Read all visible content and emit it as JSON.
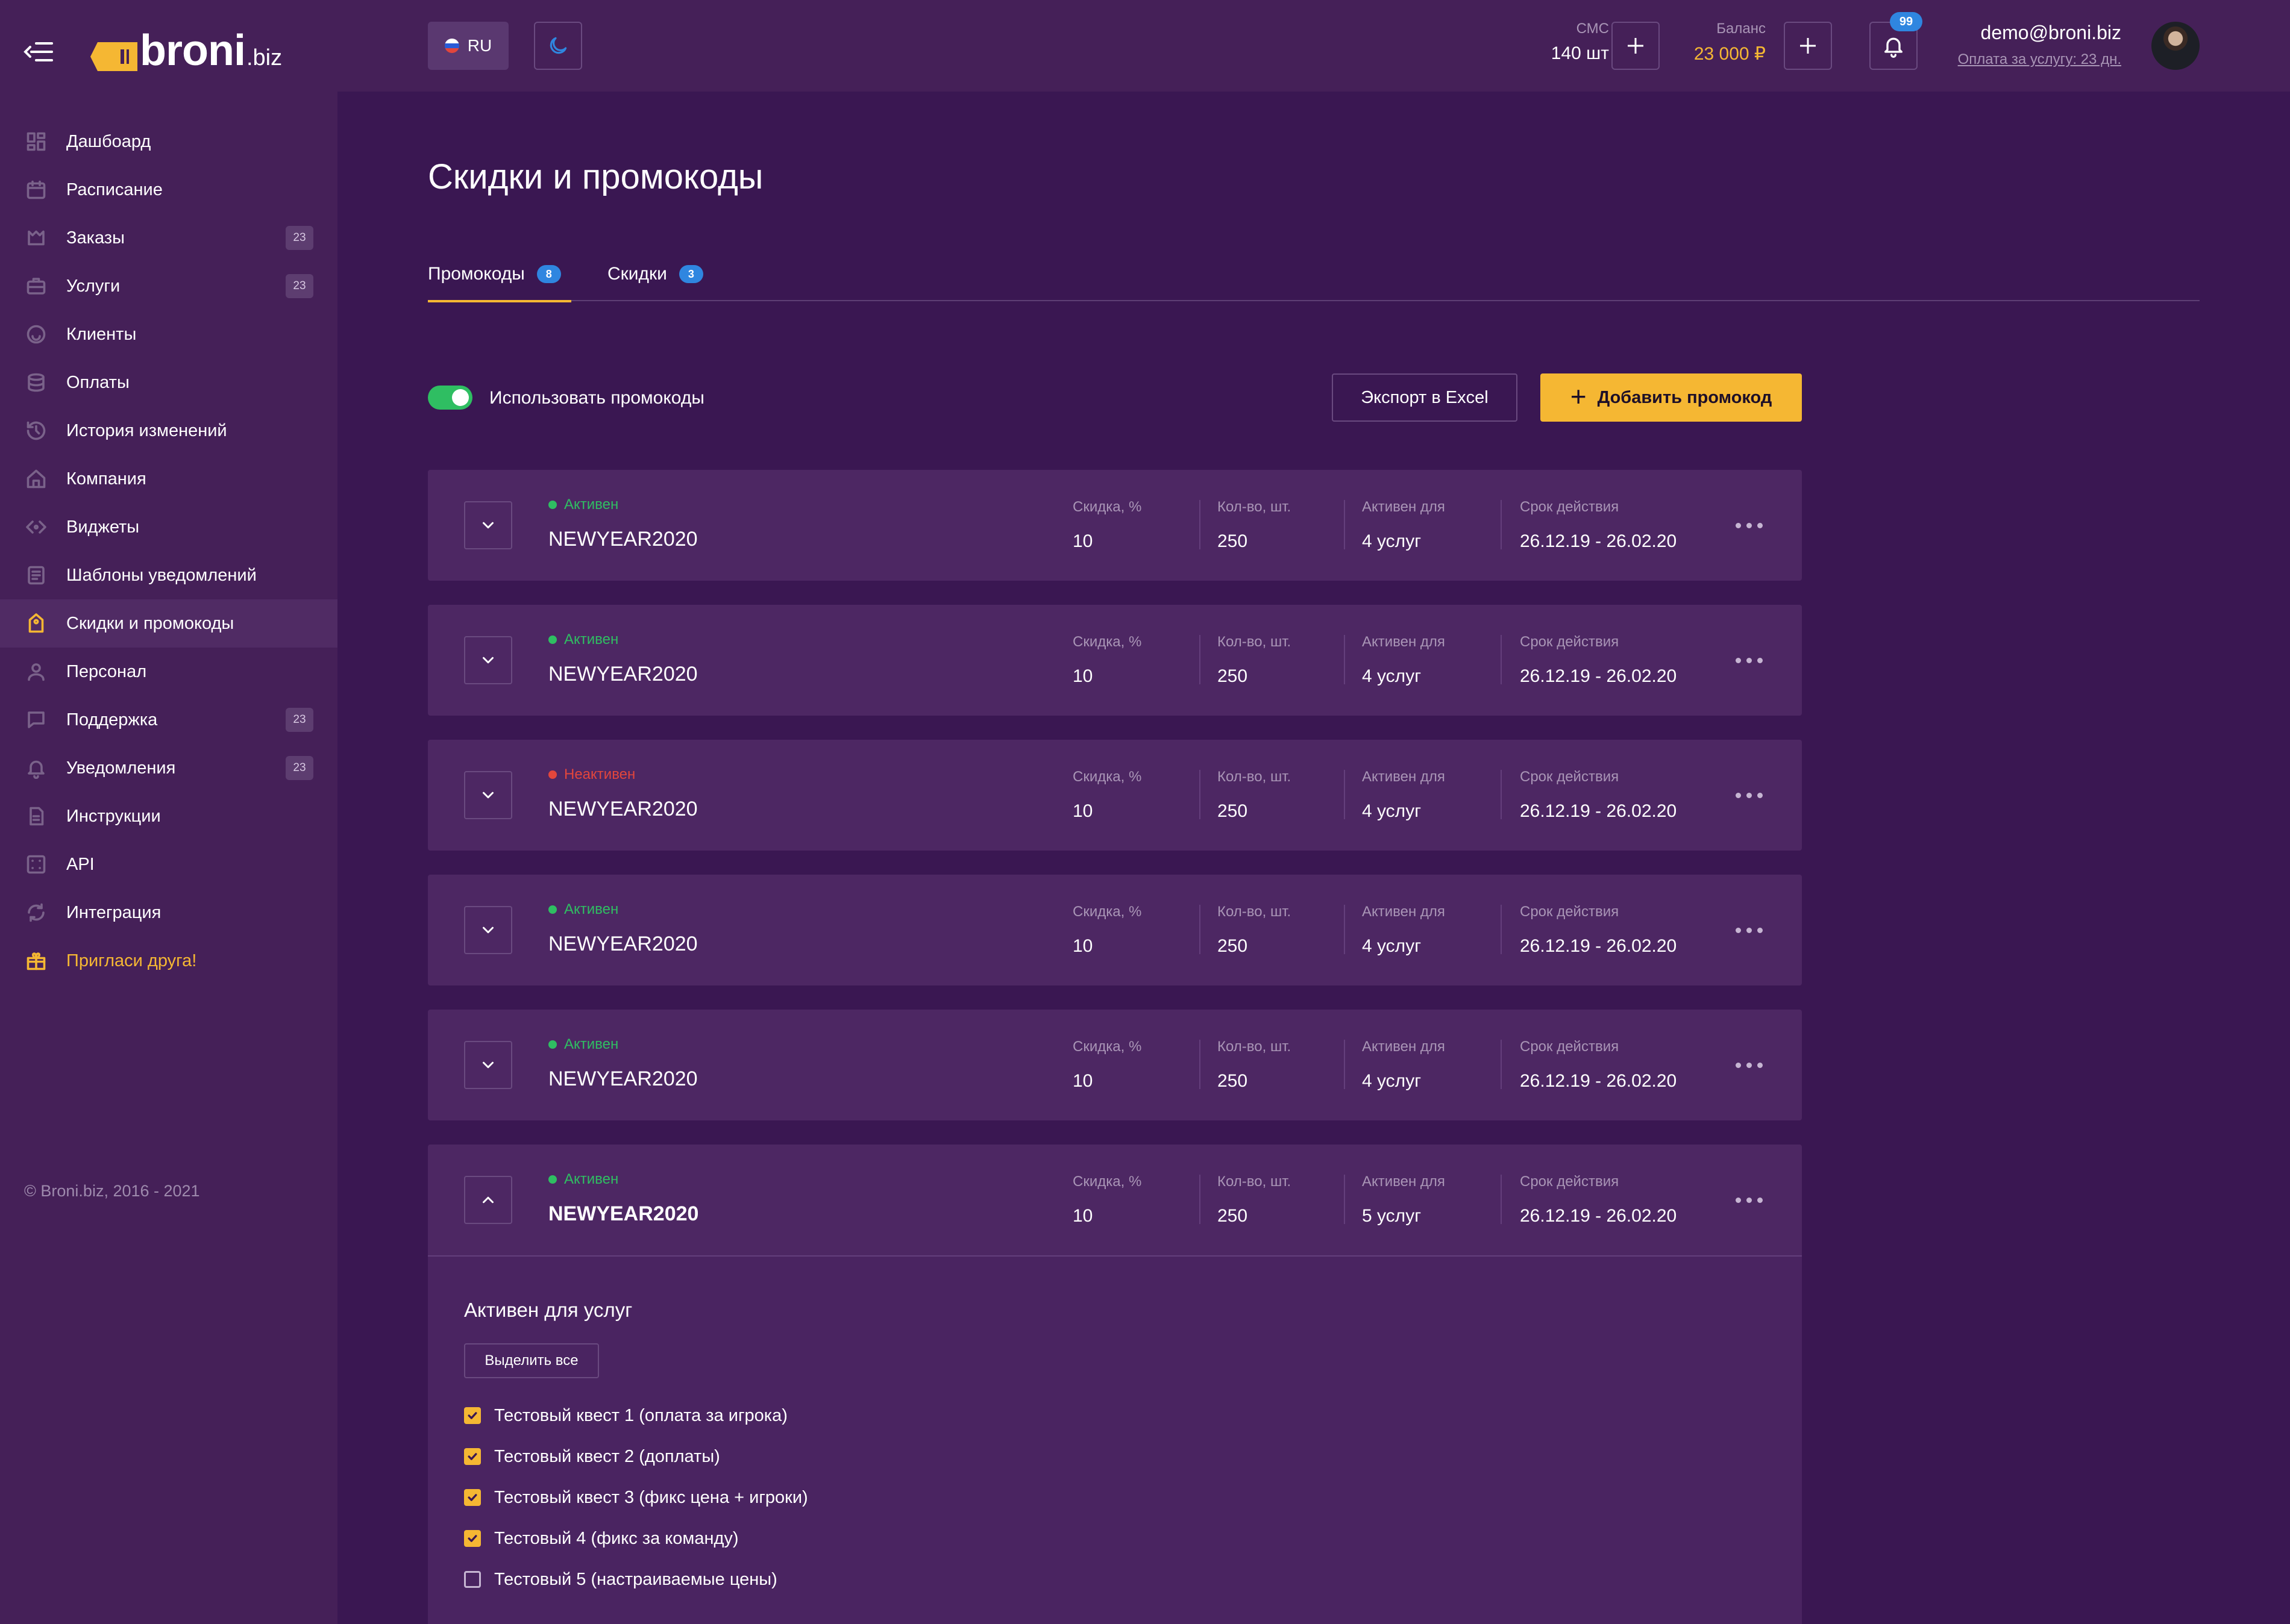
{
  "brand": {
    "name": "broni",
    "suffix": ".biz"
  },
  "sidebar": {
    "items": [
      {
        "label": "Дашбоард",
        "icon": "dashboard-icon",
        "badge": null
      },
      {
        "label": "Расписание",
        "icon": "calendar-icon",
        "badge": null
      },
      {
        "label": "Заказы",
        "icon": "orders-icon",
        "badge": "23"
      },
      {
        "label": "Услуги",
        "icon": "briefcase-icon",
        "badge": "23"
      },
      {
        "label": "Клиенты",
        "icon": "smile-icon",
        "badge": null
      },
      {
        "label": "Оплаты",
        "icon": "coins-icon",
        "badge": null
      },
      {
        "label": "История изменений",
        "icon": "history-icon",
        "badge": null
      },
      {
        "label": "Компания",
        "icon": "home-icon",
        "badge": null
      },
      {
        "label": "Виджеты",
        "icon": "code-icon",
        "badge": null
      },
      {
        "label": "Шаблоны уведомлений",
        "icon": "template-icon",
        "badge": null
      },
      {
        "label": "Скидки и промокоды",
        "icon": "tag-icon",
        "badge": null,
        "active": true
      },
      {
        "label": "Персонал",
        "icon": "user-icon",
        "badge": null
      },
      {
        "label": "Поддержка",
        "icon": "chat-icon",
        "badge": "23"
      },
      {
        "label": "Уведомления",
        "icon": "bell-icon",
        "badge": "23"
      },
      {
        "label": "Инструкции",
        "icon": "document-icon",
        "badge": null
      },
      {
        "label": "API",
        "icon": "api-icon",
        "badge": null
      },
      {
        "label": "Интеграция",
        "icon": "sync-icon",
        "badge": null
      },
      {
        "label": "Пригласи друга!",
        "icon": "gift-icon",
        "badge": null,
        "accent": true
      }
    ],
    "copyright": "© Broni.biz, 2016 - 2021"
  },
  "header": {
    "lang": "RU",
    "sms_label": "СМС",
    "sms_value": "140 шт",
    "balance_label": "Баланс",
    "balance_value": "23 000 ₽",
    "notif_count": "99",
    "user_email": "demo@broni.biz",
    "user_sub": "Оплата за услугу: 23 дн."
  },
  "page": {
    "title": "Скидки и промокоды",
    "tabs": [
      {
        "label": "Промокоды",
        "count": "8",
        "active": true
      },
      {
        "label": "Скидки",
        "count": "3",
        "active": false
      }
    ],
    "toggle_label": "Использовать промокоды",
    "toggle_on": true,
    "export_label": "Экспорт в Excel",
    "add_label": "Добавить промокод"
  },
  "columns": {
    "discount": "Скидка, %",
    "qty": "Кол-во, шт.",
    "active_for": "Активен для",
    "validity": "Срок действия"
  },
  "promos": [
    {
      "status": "Активен",
      "active": true,
      "code": "NEWYEAR2020",
      "discount": "10",
      "qty": "250",
      "active_for": "4 услуг",
      "validity": "26.12.19 - 26.02.20"
    },
    {
      "status": "Активен",
      "active": true,
      "code": "NEWYEAR2020",
      "discount": "10",
      "qty": "250",
      "active_for": "4 услуг",
      "validity": "26.12.19 - 26.02.20"
    },
    {
      "status": "Неактивен",
      "active": false,
      "code": "NEWYEAR2020",
      "discount": "10",
      "qty": "250",
      "active_for": "4 услуг",
      "validity": "26.12.19 - 26.02.20"
    },
    {
      "status": "Активен",
      "active": true,
      "code": "NEWYEAR2020",
      "discount": "10",
      "qty": "250",
      "active_for": "4 услуг",
      "validity": "26.12.19 - 26.02.20"
    },
    {
      "status": "Активен",
      "active": true,
      "code": "NEWYEAR2020",
      "discount": "10",
      "qty": "250",
      "active_for": "4 услуг",
      "validity": "26.12.19 - 26.02.20"
    },
    {
      "status": "Активен",
      "active": true,
      "code": "NEWYEAR2020",
      "discount": "10",
      "qty": "250",
      "active_for": "5 услуг",
      "validity": "26.12.19 - 26.02.20",
      "expanded": true
    }
  ],
  "expanded_panel": {
    "title": "Активен для услуг",
    "select_all": "Выделить все",
    "services": [
      {
        "label": "Тестовый квест 1 (оплата за игрока)",
        "checked": true
      },
      {
        "label": "Тестовый квест 2 (доплаты)",
        "checked": true
      },
      {
        "label": "Тестовый квест 3 (фикс цена + игроки)",
        "checked": true
      },
      {
        "label": "Тестовый 4 (фикс за команду)",
        "checked": true
      },
      {
        "label": "Тестовый 5 (настраиваемые цены)",
        "checked": false
      }
    ]
  },
  "colors": {
    "accent": "#f5b733",
    "active_status": "#2fbe62",
    "inactive_status": "#e2463c",
    "badge_blue": "#2f86e0"
  }
}
